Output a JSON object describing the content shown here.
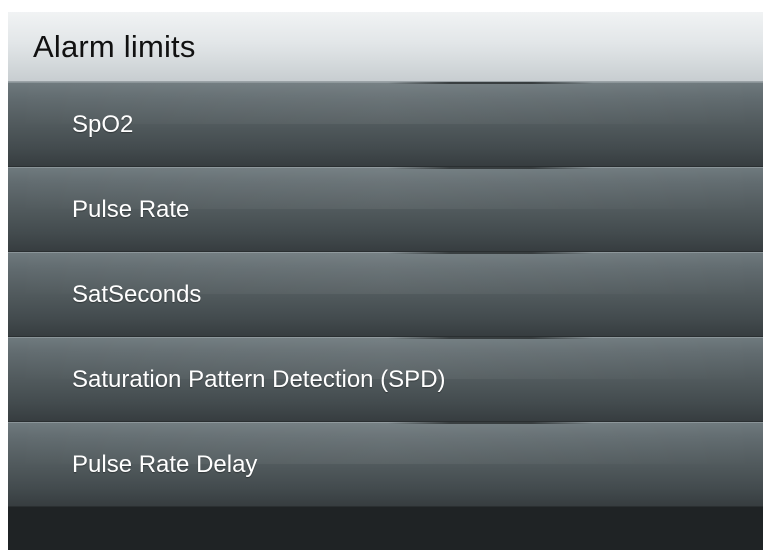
{
  "header": {
    "title": "Alarm limits"
  },
  "menu": {
    "items": [
      {
        "label": "SpO2"
      },
      {
        "label": "Pulse Rate"
      },
      {
        "label": "SatSeconds"
      },
      {
        "label": "Saturation Pattern Detection (SPD)"
      },
      {
        "label": "Pulse Rate Delay"
      }
    ]
  },
  "colors": {
    "header_background": "#e2e6e8",
    "item_background": "#525b5e",
    "item_text": "#ffffff",
    "footer_background": "#1f2325"
  }
}
